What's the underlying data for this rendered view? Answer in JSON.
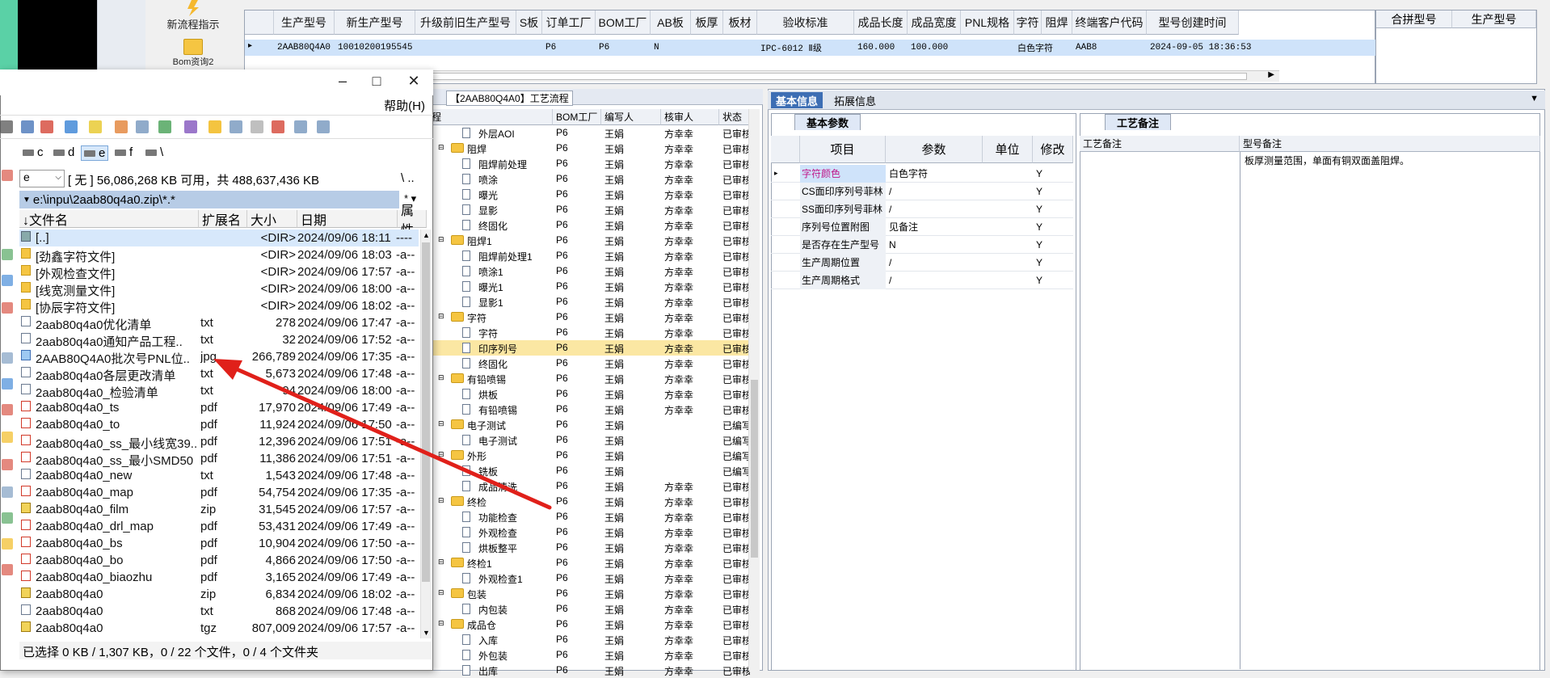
{
  "toolbar": {
    "btn1_label": "新流程指示",
    "btn2_label": "Bom资询2"
  },
  "main_grid": {
    "columns": [
      "生产型号",
      "新生产型号",
      "升级前旧生产型号",
      "S板",
      "订单工厂",
      "BOM工厂",
      "AB板",
      "板厚",
      "板材",
      "验收标准",
      "成品长度",
      "成品宽度",
      "PNL规格",
      "字符",
      "阻焊",
      "终端客户代码",
      "型号创建时间"
    ],
    "row": {
      "c0": "2AAB80Q4A0",
      "c1": "10010200195545",
      "c4": "P6",
      "c5": "P6",
      "c6": "N",
      "c9": "IPC-6012 Ⅱ级",
      "c10": "160.000",
      "c11": "100.000",
      "c13": "白色字符",
      "c15": "AAB8",
      "c16": "2024-09-05 18:36:53"
    }
  },
  "side_grid": {
    "columns": [
      "合拼型号",
      "生产型号"
    ]
  },
  "process": {
    "title": "【2AAB80Q4A0】工艺流程",
    "columns": [
      "程",
      "BOM工厂",
      "编写人",
      "核审人",
      "状态"
    ],
    "rows": [
      {
        "name": "外层AOI",
        "type": "file",
        "bom": "P6",
        "writer": "王娟",
        "reviewer": "方幸幸",
        "status": "已审核"
      },
      {
        "name": "阻焊",
        "type": "folder",
        "bom": "P6",
        "writer": "王娟",
        "reviewer": "方幸幸",
        "status": "已审核"
      },
      {
        "name": "阻焊前处理",
        "type": "file",
        "bom": "P6",
        "writer": "王娟",
        "reviewer": "方幸幸",
        "status": "已审核"
      },
      {
        "name": "喷涂",
        "type": "file",
        "bom": "P6",
        "writer": "王娟",
        "reviewer": "方幸幸",
        "status": "已审核"
      },
      {
        "name": "曝光",
        "type": "file",
        "bom": "P6",
        "writer": "王娟",
        "reviewer": "方幸幸",
        "status": "已审核"
      },
      {
        "name": "显影",
        "type": "file",
        "bom": "P6",
        "writer": "王娟",
        "reviewer": "方幸幸",
        "status": "已审核"
      },
      {
        "name": "终固化",
        "type": "file",
        "bom": "P6",
        "writer": "王娟",
        "reviewer": "方幸幸",
        "status": "已审核"
      },
      {
        "name": "阻焊1",
        "type": "folder",
        "bom": "P6",
        "writer": "王娟",
        "reviewer": "方幸幸",
        "status": "已审核"
      },
      {
        "name": "阻焊前处理1",
        "type": "file",
        "bom": "P6",
        "writer": "王娟",
        "reviewer": "方幸幸",
        "status": "已审核"
      },
      {
        "name": "喷涂1",
        "type": "file",
        "bom": "P6",
        "writer": "王娟",
        "reviewer": "方幸幸",
        "status": "已审核"
      },
      {
        "name": "曝光1",
        "type": "file",
        "bom": "P6",
        "writer": "王娟",
        "reviewer": "方幸幸",
        "status": "已审核"
      },
      {
        "name": "显影1",
        "type": "file",
        "bom": "P6",
        "writer": "王娟",
        "reviewer": "方幸幸",
        "status": "已审核"
      },
      {
        "name": "字符",
        "type": "folder",
        "bom": "P6",
        "writer": "王娟",
        "reviewer": "方幸幸",
        "status": "已审核"
      },
      {
        "name": "字符",
        "type": "file",
        "bom": "P6",
        "writer": "王娟",
        "reviewer": "方幸幸",
        "status": "已审核"
      },
      {
        "name": "印序列号",
        "type": "file",
        "bom": "P6",
        "writer": "王娟",
        "reviewer": "方幸幸",
        "status": "已审核"
      },
      {
        "name": "终固化",
        "type": "file",
        "bom": "P6",
        "writer": "王娟",
        "reviewer": "方幸幸",
        "status": "已审核"
      },
      {
        "name": "有铅喷锡",
        "type": "folder",
        "bom": "P6",
        "writer": "王娟",
        "reviewer": "方幸幸",
        "status": "已审核"
      },
      {
        "name": "烘板",
        "type": "file",
        "bom": "P6",
        "writer": "王娟",
        "reviewer": "方幸幸",
        "status": "已审核"
      },
      {
        "name": "有铅喷锡",
        "type": "file",
        "bom": "P6",
        "writer": "王娟",
        "reviewer": "方幸幸",
        "status": "已审核"
      },
      {
        "name": "电子测试",
        "type": "folder",
        "bom": "P6",
        "writer": "王娟",
        "reviewer": "",
        "status": "已编写"
      },
      {
        "name": "电子测试",
        "type": "file",
        "bom": "P6",
        "writer": "王娟",
        "reviewer": "",
        "status": "已编写"
      },
      {
        "name": "外形",
        "type": "folder",
        "bom": "P6",
        "writer": "王娟",
        "reviewer": "",
        "status": "已编写"
      },
      {
        "name": "铣板",
        "type": "file",
        "bom": "P6",
        "writer": "王娟",
        "reviewer": "",
        "status": "已编写"
      },
      {
        "name": "成品清洗",
        "type": "file",
        "bom": "P6",
        "writer": "王娟",
        "reviewer": "方幸幸",
        "status": "已审核"
      },
      {
        "name": "终检",
        "type": "folder",
        "bom": "P6",
        "writer": "王娟",
        "reviewer": "方幸幸",
        "status": "已审核"
      },
      {
        "name": "功能检查",
        "type": "file",
        "bom": "P6",
        "writer": "王娟",
        "reviewer": "方幸幸",
        "status": "已审核"
      },
      {
        "name": "外观检查",
        "type": "file",
        "bom": "P6",
        "writer": "王娟",
        "reviewer": "方幸幸",
        "status": "已审核"
      },
      {
        "name": "烘板整平",
        "type": "file",
        "bom": "P6",
        "writer": "王娟",
        "reviewer": "方幸幸",
        "status": "已审核"
      },
      {
        "name": "终检1",
        "type": "folder",
        "bom": "P6",
        "writer": "王娟",
        "reviewer": "方幸幸",
        "status": "已审核"
      },
      {
        "name": "外观检查1",
        "type": "file",
        "bom": "P6",
        "writer": "王娟",
        "reviewer": "方幸幸",
        "status": "已审核"
      },
      {
        "name": "包装",
        "type": "folder",
        "bom": "P6",
        "writer": "王娟",
        "reviewer": "方幸幸",
        "status": "已审核"
      },
      {
        "name": "内包装",
        "type": "file",
        "bom": "P6",
        "writer": "王娟",
        "reviewer": "方幸幸",
        "status": "已审核"
      },
      {
        "name": "成品仓",
        "type": "folder",
        "bom": "P6",
        "writer": "王娟",
        "reviewer": "方幸幸",
        "status": "已审核"
      },
      {
        "name": "入库",
        "type": "file",
        "bom": "P6",
        "writer": "王娟",
        "reviewer": "方幸幸",
        "status": "已审核"
      },
      {
        "name": "外包装",
        "type": "file",
        "bom": "P6",
        "writer": "王娟",
        "reviewer": "方幸幸",
        "status": "已审核"
      },
      {
        "name": "出库",
        "type": "file",
        "bom": "P6",
        "writer": "王娟",
        "reviewer": "方幸幸",
        "status": "已审核"
      }
    ]
  },
  "right_panel": {
    "tab_basic": "基本信息",
    "tab_expand": "拓展信息",
    "params_tab": "基本参数",
    "params_headers": [
      "项目",
      "参数",
      "单位",
      "修改"
    ],
    "params": [
      {
        "item": "字符颜色",
        "value": "白色字符",
        "unit": "",
        "edit": "Y"
      },
      {
        "item": "CS面印序列号菲林",
        "value": "/",
        "unit": "",
        "edit": "Y"
      },
      {
        "item": "SS面印序列号菲林",
        "value": "/",
        "unit": "",
        "edit": "Y"
      },
      {
        "item": "序列号位置附图",
        "value": "见备注",
        "unit": "",
        "edit": "Y"
      },
      {
        "item": "是否存在生产型号",
        "value": "N",
        "unit": "",
        "edit": "Y"
      },
      {
        "item": "生产周期位置",
        "value": "/",
        "unit": "",
        "edit": "Y"
      },
      {
        "item": "生产周期格式",
        "value": "/",
        "unit": "",
        "edit": "Y"
      }
    ],
    "notes_tab": "工艺备注",
    "notes_headers": [
      "工艺备注",
      "型号备注"
    ],
    "model_note": "板厚测量范围，单面有铜双面盖阻焊。"
  },
  "file_manager": {
    "help_menu": "帮助(H)",
    "drives": [
      "c",
      "d",
      "e",
      "f",
      "\\"
    ],
    "drive_select": "e",
    "status": "[ 无 ]  56,086,268 KB 可用，共 488,637,436 KB",
    "path_right": "\\   ..",
    "path": "e:\\inpu\\2aab80q4a0.zip\\*.*",
    "path_filter": "* ▾",
    "headers": [
      "↓文件名",
      "扩展名",
      "大小",
      "日期",
      "属性"
    ],
    "rows": [
      {
        "name": "[..]",
        "ext": "",
        "size": "<DIR>",
        "date": "2024/09/06 18:11",
        "attr": "----",
        "icon": "up"
      },
      {
        "name": "[劲鑫字符文件]",
        "ext": "",
        "size": "<DIR>",
        "date": "2024/09/06 18:03",
        "attr": "-a--",
        "icon": "dir"
      },
      {
        "name": "[外观检查文件]",
        "ext": "",
        "size": "<DIR>",
        "date": "2024/09/06 17:57",
        "attr": "-a--",
        "icon": "dir"
      },
      {
        "name": "[线宽测量文件]",
        "ext": "",
        "size": "<DIR>",
        "date": "2024/09/06 18:00",
        "attr": "-a--",
        "icon": "dir"
      },
      {
        "name": "[协辰字符文件]",
        "ext": "",
        "size": "<DIR>",
        "date": "2024/09/06 18:02",
        "attr": "-a--",
        "icon": "dir"
      },
      {
        "name": "2aab80q4a0优化清单",
        "ext": "txt",
        "size": "278",
        "date": "2024/09/06 17:47",
        "attr": "-a--",
        "icon": "txt"
      },
      {
        "name": "2aab80q4a0通知产品工程..",
        "ext": "txt",
        "size": "32",
        "date": "2024/09/06 17:52",
        "attr": "-a--",
        "icon": "txt"
      },
      {
        "name": "2AAB80Q4A0批次号PNL位..",
        "ext": "jpg",
        "size": "266,789",
        "date": "2024/09/06 17:35",
        "attr": "-a--",
        "icon": "img"
      },
      {
        "name": "2aab80q4a0各层更改清单",
        "ext": "txt",
        "size": "5,673",
        "date": "2024/09/06 17:48",
        "attr": "-a--",
        "icon": "txt"
      },
      {
        "name": "2aab80q4a0_检验清单",
        "ext": "txt",
        "size": "94",
        "date": "2024/09/06 18:00",
        "attr": "-a--",
        "icon": "txt"
      },
      {
        "name": "2aab80q4a0_ts",
        "ext": "pdf",
        "size": "17,970",
        "date": "2024/09/06 17:49",
        "attr": "-a--",
        "icon": "pdf"
      },
      {
        "name": "2aab80q4a0_to",
        "ext": "pdf",
        "size": "11,924",
        "date": "2024/09/06 17:50",
        "attr": "-a--",
        "icon": "pdf"
      },
      {
        "name": "2aab80q4a0_ss_最小线宽39..",
        "ext": "pdf",
        "size": "12,396",
        "date": "2024/09/06 17:51",
        "attr": "-a--",
        "icon": "pdf"
      },
      {
        "name": "2aab80q4a0_ss_最小SMD50",
        "ext": "pdf",
        "size": "11,386",
        "date": "2024/09/06 17:51",
        "attr": "-a--",
        "icon": "pdf"
      },
      {
        "name": "2aab80q4a0_new",
        "ext": "txt",
        "size": "1,543",
        "date": "2024/09/06 17:48",
        "attr": "-a--",
        "icon": "txt"
      },
      {
        "name": "2aab80q4a0_map",
        "ext": "pdf",
        "size": "54,754",
        "date": "2024/09/06 17:35",
        "attr": "-a--",
        "icon": "pdf"
      },
      {
        "name": "2aab80q4a0_film",
        "ext": "zip",
        "size": "31,545",
        "date": "2024/09/06 17:57",
        "attr": "-a--",
        "icon": "zip"
      },
      {
        "name": "2aab80q4a0_drl_map",
        "ext": "pdf",
        "size": "53,431",
        "date": "2024/09/06 17:49",
        "attr": "-a--",
        "icon": "pdf"
      },
      {
        "name": "2aab80q4a0_bs",
        "ext": "pdf",
        "size": "10,904",
        "date": "2024/09/06 17:50",
        "attr": "-a--",
        "icon": "pdf"
      },
      {
        "name": "2aab80q4a0_bo",
        "ext": "pdf",
        "size": "4,866",
        "date": "2024/09/06 17:50",
        "attr": "-a--",
        "icon": "pdf"
      },
      {
        "name": "2aab80q4a0_biaozhu",
        "ext": "pdf",
        "size": "3,165",
        "date": "2024/09/06 17:49",
        "attr": "-a--",
        "icon": "pdf"
      },
      {
        "name": "2aab80q4a0",
        "ext": "zip",
        "size": "6,834",
        "date": "2024/09/06 18:02",
        "attr": "-a--",
        "icon": "zip"
      },
      {
        "name": "2aab80q4a0",
        "ext": "txt",
        "size": "868",
        "date": "2024/09/06 17:48",
        "attr": "-a--",
        "icon": "txt"
      },
      {
        "name": "2aab80q4a0",
        "ext": "tgz",
        "size": "807,009",
        "date": "2024/09/06 17:57",
        "attr": "-a--",
        "icon": "zip"
      }
    ],
    "footer": "已选择 0 KB / 1,307 KB，0 / 22 个文件，0 / 4 个文件夹"
  },
  "colors": {
    "accent": "#3d6eb4",
    "selection": "#cfe3fa",
    "tree_highlight": "#fbe7a3",
    "annotation_arrow": "#e0201a"
  }
}
